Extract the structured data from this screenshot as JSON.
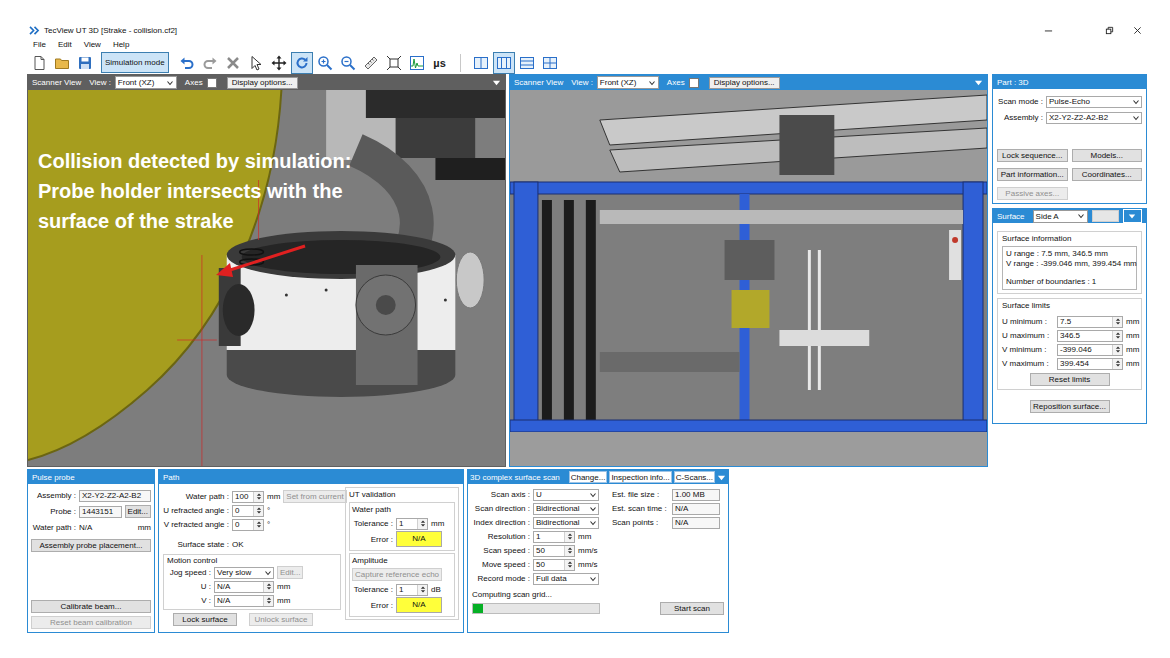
{
  "window": {
    "title": "TecView UT 3D [Strake - collision.cf2]"
  },
  "menu": [
    {
      "label": "File"
    },
    {
      "label": "Edit"
    },
    {
      "label": "View"
    },
    {
      "label": "Help"
    }
  ],
  "toolbar": [
    {
      "kind": "icon",
      "selected": false
    },
    {
      "kind": "icon",
      "selected": false
    },
    {
      "kind": "icon",
      "selected": false
    },
    {
      "kind": "toggle",
      "label": "Simulation mode",
      "selected": true
    },
    {
      "kind": "icon",
      "selected": false
    },
    {
      "kind": "icon",
      "selected": false
    },
    {
      "kind": "icon",
      "selected": false
    },
    {
      "kind": "icon",
      "selected": false
    },
    {
      "kind": "icon",
      "selected": false
    },
    {
      "kind": "icon",
      "selected": true
    },
    {
      "kind": "icon",
      "selected": false
    },
    {
      "kind": "icon",
      "selected": false
    },
    {
      "kind": "icon",
      "selected": false
    },
    {
      "kind": "icon",
      "selected": false
    },
    {
      "kind": "icon",
      "selected": false
    },
    {
      "kind": "text",
      "label": "µs",
      "selected": false
    },
    {
      "kind": "icon",
      "selected": false
    },
    {
      "kind": "icon",
      "selected": true
    },
    {
      "kind": "icon",
      "selected": false
    },
    {
      "kind": "icon",
      "selected": false
    }
  ],
  "views": [
    {
      "title": "Scanner View",
      "active": false,
      "view_label": "View :",
      "view": "Front (XZ)",
      "axes_label": "Axes",
      "axes_checked": false,
      "display_options": "Display options...",
      "kind": "closeup",
      "annotation": [
        "Collision detected by simulation:",
        "Probe holder intersects with the",
        "surface of the strake"
      ]
    },
    {
      "title": "Scanner View",
      "active": true,
      "view_label": "View :",
      "view": "Front (XZ)",
      "axes_label": "Axes",
      "axes_checked": false,
      "display_options": "Display options...",
      "kind": "overview",
      "annotation": []
    }
  ],
  "part": {
    "title": "Part : 3D",
    "fields": [
      {
        "label": "Scan mode :",
        "kind": "select",
        "value": "Pulse-Echo"
      },
      {
        "label": "Assembly :",
        "kind": "select",
        "value": "X2-Y2-Z2-A2-B2"
      }
    ],
    "buttons": [
      {
        "label": "Lock sequence...",
        "disabled": false
      },
      {
        "label": "Models...",
        "disabled": false
      },
      {
        "label": "Part information...",
        "disabled": false
      },
      {
        "label": "Coordinates...",
        "disabled": false
      },
      {
        "label": "Passive axes...",
        "disabled": true
      }
    ]
  },
  "surface": {
    "title": "Surface",
    "side": "Side A",
    "side_button": {
      "disabled": true
    },
    "info_title": "Surface information",
    "info": [
      "U range : 7.5 mm, 346.5 mm",
      "V range : -399.046 mm, 399.454 mm",
      "Number of boundaries : 1"
    ],
    "limits_title": "Surface limits",
    "limits": [
      {
        "label": "U minimum :",
        "kind": "spin",
        "value": "7.5",
        "unit": "mm"
      },
      {
        "label": "U maximum :",
        "kind": "spin",
        "value": "346.5",
        "unit": "mm"
      },
      {
        "label": "V minimum :",
        "kind": "spin",
        "value": "-399.046",
        "unit": "mm"
      },
      {
        "label": "V maximum :",
        "kind": "spin",
        "value": "399.454",
        "unit": "mm"
      }
    ],
    "reset": {
      "label": "Reset limits",
      "disabled": false
    },
    "reposition": {
      "label": "Reposition surface...",
      "disabled": false
    }
  },
  "pulse_probe": {
    "title": "Pulse probe",
    "fields": [
      {
        "label": "Assembly :",
        "kind": "readonly",
        "value": "X2-Y2-Z2-A2-B2"
      },
      {
        "label": "Probe :",
        "kind": "readonly",
        "value": "1443151",
        "button": {
          "label": "Edit...",
          "disabled": false
        }
      },
      {
        "label": "Water path :",
        "kind": "plain",
        "value": "N/A",
        "unit": "mm"
      }
    ],
    "placement": {
      "label": "Assembly probe placement...",
      "disabled": false
    },
    "calibration": [
      {
        "label": "Calibrate beam...",
        "disabled": false
      },
      {
        "label": "Reset beam calibration",
        "disabled": true
      }
    ]
  },
  "path": {
    "title": "Path",
    "fields": [
      {
        "label": "Water path :",
        "kind": "spin",
        "value": "100",
        "unit": "mm",
        "button": {
          "label": "Set from current",
          "disabled": true
        }
      },
      {
        "label": "U refracted angle :",
        "kind": "spin",
        "value": "0",
        "unit": "°"
      },
      {
        "label": "V refracted angle :",
        "kind": "spin",
        "value": "0",
        "unit": "°"
      }
    ],
    "surface_state": {
      "label": "Surface state :",
      "kind": "plain",
      "value": "OK"
    },
    "motion": {
      "title": "Motion control",
      "fields": [
        {
          "label": "Jog speed :",
          "kind": "select",
          "value": "Very slow",
          "button": {
            "label": "Edit...",
            "disabled": true
          }
        },
        {
          "label": "U :",
          "kind": "spin",
          "value": "N/A",
          "unit": "mm"
        },
        {
          "label": "V :",
          "kind": "spin",
          "value": "N/A",
          "unit": "mm"
        }
      ]
    },
    "buttons": [
      {
        "label": "Lock surface",
        "disabled": false
      },
      {
        "label": "Unlock surface",
        "disabled": true
      }
    ],
    "validation": {
      "title": "UT validation",
      "groups": [
        {
          "title": "Water path",
          "fields": [
            {
              "label": "Tolerance :",
              "kind": "spin",
              "value": "1",
              "unit": "mm"
            },
            {
              "label": "Error :",
              "kind": "error",
              "value": "N/A"
            }
          ]
        },
        {
          "title": "Amplitude",
          "button": {
            "label": "Capture reference echo",
            "disabled": true
          },
          "fields": [
            {
              "label": "Tolerance :",
              "kind": "spin",
              "value": "1",
              "unit": "dB"
            },
            {
              "label": "Error :",
              "kind": "error",
              "value": "N/A"
            }
          ]
        }
      ]
    }
  },
  "scan": {
    "title": "3D complex surface scan",
    "tabs": [
      {
        "label": "Change..."
      },
      {
        "label": "Inspection info..."
      },
      {
        "label": "C-Scans..."
      }
    ],
    "fields": [
      {
        "label": "Scan axis :",
        "kind": "select",
        "value": "U"
      },
      {
        "label": "Scan direction :",
        "kind": "select",
        "value": "Bidirectional"
      },
      {
        "label": "Index direction :",
        "kind": "select",
        "value": "Bidirectional"
      },
      {
        "label": "Resolution :",
        "kind": "spin",
        "value": "1",
        "unit": "mm"
      },
      {
        "label": "Scan speed :",
        "kind": "spin",
        "value": "50",
        "unit": "mm/s"
      },
      {
        "label": "Move speed :",
        "kind": "spin",
        "value": "50",
        "unit": "mm/s"
      },
      {
        "label": "Record mode :",
        "kind": "select",
        "value": "Full data"
      }
    ],
    "estimates": [
      {
        "label": "Est. file size :",
        "kind": "readonly",
        "value": "1.00 MB"
      },
      {
        "label": "Est. scan time :",
        "kind": "readonly",
        "value": "N/A"
      },
      {
        "label": "Scan points :",
        "kind": "readonly",
        "value": "N/A"
      }
    ],
    "progress": {
      "label": "Computing scan grid...",
      "level": 0.08
    },
    "start": {
      "label": "Start scan",
      "disabled": false
    }
  }
}
